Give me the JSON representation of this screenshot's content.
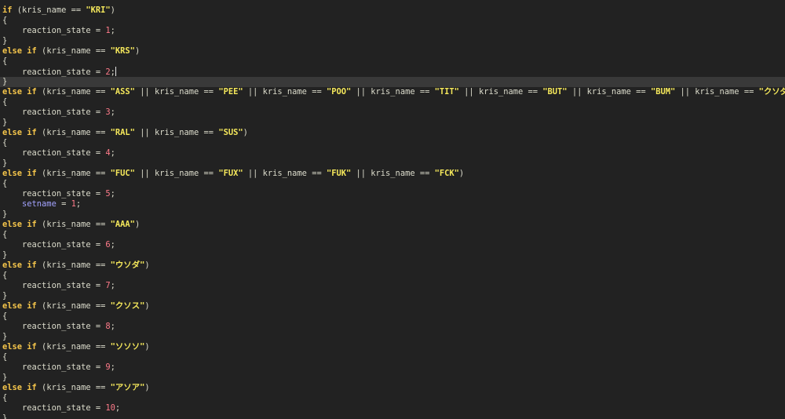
{
  "colors": {
    "background": "#222222",
    "current_line": "#393939",
    "keyword": "#f6c64b",
    "string": "#f5e85b",
    "number": "#ff7b8a",
    "variable": "#dcdccc",
    "builtin": "#a3a3ff"
  },
  "editor": {
    "current_line_index": 7,
    "lines": [
      [
        [
          "kw",
          "if"
        ],
        [
          "pun",
          " ("
        ],
        [
          "var",
          "kris_name"
        ],
        [
          "op",
          " == "
        ],
        [
          "str",
          "\"KRI\""
        ],
        [
          "pun",
          ")"
        ]
      ],
      [
        [
          "pun",
          "{"
        ]
      ],
      [
        [
          "pun",
          "    "
        ],
        [
          "var",
          "reaction_state"
        ],
        [
          "op",
          " = "
        ],
        [
          "num",
          "1"
        ],
        [
          "pun",
          ";"
        ]
      ],
      [
        [
          "pun",
          "}"
        ]
      ],
      [
        [
          "kw",
          "else if"
        ],
        [
          "pun",
          " ("
        ],
        [
          "var",
          "kris_name"
        ],
        [
          "op",
          " == "
        ],
        [
          "str",
          "\"KRS\""
        ],
        [
          "pun",
          ")"
        ]
      ],
      [
        [
          "pun",
          "{"
        ]
      ],
      [
        [
          "pun",
          "    "
        ],
        [
          "var",
          "reaction_state"
        ],
        [
          "op",
          " = "
        ],
        [
          "num",
          "2"
        ],
        [
          "pun",
          ";"
        ],
        [
          "cursor",
          ""
        ]
      ],
      [
        [
          "pun",
          "}"
        ]
      ],
      [
        [
          "kw",
          "else if"
        ],
        [
          "pun",
          " ("
        ],
        [
          "var",
          "kris_name"
        ],
        [
          "op",
          " == "
        ],
        [
          "str",
          "\"ASS\""
        ],
        [
          "op",
          " || "
        ],
        [
          "var",
          "kris_name"
        ],
        [
          "op",
          " == "
        ],
        [
          "str",
          "\"PEE\""
        ],
        [
          "op",
          " || "
        ],
        [
          "var",
          "kris_name"
        ],
        [
          "op",
          " == "
        ],
        [
          "str",
          "\"POO\""
        ],
        [
          "op",
          " || "
        ],
        [
          "var",
          "kris_name"
        ],
        [
          "op",
          " == "
        ],
        [
          "str",
          "\"TIT\""
        ],
        [
          "op",
          " || "
        ],
        [
          "var",
          "kris_name"
        ],
        [
          "op",
          " == "
        ],
        [
          "str",
          "\"BUT\""
        ],
        [
          "op",
          " || "
        ],
        [
          "var",
          "kris_name"
        ],
        [
          "op",
          " == "
        ],
        [
          "str",
          "\"BUM\""
        ],
        [
          "op",
          " || "
        ],
        [
          "var",
          "kris_name"
        ],
        [
          "op",
          " == "
        ],
        [
          "str",
          "\"クソダ\""
        ],
        [
          "pun",
          ")"
        ]
      ],
      [
        [
          "pun",
          "{"
        ]
      ],
      [
        [
          "pun",
          "    "
        ],
        [
          "var",
          "reaction_state"
        ],
        [
          "op",
          " = "
        ],
        [
          "num",
          "3"
        ],
        [
          "pun",
          ";"
        ]
      ],
      [
        [
          "pun",
          "}"
        ]
      ],
      [
        [
          "kw",
          "else if"
        ],
        [
          "pun",
          " ("
        ],
        [
          "var",
          "kris_name"
        ],
        [
          "op",
          " == "
        ],
        [
          "str",
          "\"RAL\""
        ],
        [
          "op",
          " || "
        ],
        [
          "var",
          "kris_name"
        ],
        [
          "op",
          " == "
        ],
        [
          "str",
          "\"SUS\""
        ],
        [
          "pun",
          ")"
        ]
      ],
      [
        [
          "pun",
          "{"
        ]
      ],
      [
        [
          "pun",
          "    "
        ],
        [
          "var",
          "reaction_state"
        ],
        [
          "op",
          " = "
        ],
        [
          "num",
          "4"
        ],
        [
          "pun",
          ";"
        ]
      ],
      [
        [
          "pun",
          "}"
        ]
      ],
      [
        [
          "kw",
          "else if"
        ],
        [
          "pun",
          " ("
        ],
        [
          "var",
          "kris_name"
        ],
        [
          "op",
          " == "
        ],
        [
          "str",
          "\"FUC\""
        ],
        [
          "op",
          " || "
        ],
        [
          "var",
          "kris_name"
        ],
        [
          "op",
          " == "
        ],
        [
          "str",
          "\"FUX\""
        ],
        [
          "op",
          " || "
        ],
        [
          "var",
          "kris_name"
        ],
        [
          "op",
          " == "
        ],
        [
          "str",
          "\"FUK\""
        ],
        [
          "op",
          " || "
        ],
        [
          "var",
          "kris_name"
        ],
        [
          "op",
          " == "
        ],
        [
          "str",
          "\"FCK\""
        ],
        [
          "pun",
          ")"
        ]
      ],
      [
        [
          "pun",
          "{"
        ]
      ],
      [
        [
          "pun",
          "    "
        ],
        [
          "var",
          "reaction_state"
        ],
        [
          "op",
          " = "
        ],
        [
          "num",
          "5"
        ],
        [
          "pun",
          ";"
        ]
      ],
      [
        [
          "pun",
          "    "
        ],
        [
          "bl",
          "setname"
        ],
        [
          "op",
          " = "
        ],
        [
          "num",
          "1"
        ],
        [
          "pun",
          ";"
        ]
      ],
      [
        [
          "pun",
          "}"
        ]
      ],
      [
        [
          "kw",
          "else if"
        ],
        [
          "pun",
          " ("
        ],
        [
          "var",
          "kris_name"
        ],
        [
          "op",
          " == "
        ],
        [
          "str",
          "\"AAA\""
        ],
        [
          "pun",
          ")"
        ]
      ],
      [
        [
          "pun",
          "{"
        ]
      ],
      [
        [
          "pun",
          "    "
        ],
        [
          "var",
          "reaction_state"
        ],
        [
          "op",
          " = "
        ],
        [
          "num",
          "6"
        ],
        [
          "pun",
          ";"
        ]
      ],
      [
        [
          "pun",
          "}"
        ]
      ],
      [
        [
          "kw",
          "else if"
        ],
        [
          "pun",
          " ("
        ],
        [
          "var",
          "kris_name"
        ],
        [
          "op",
          " == "
        ],
        [
          "str",
          "\"ウソダ\""
        ],
        [
          "pun",
          ")"
        ]
      ],
      [
        [
          "pun",
          "{"
        ]
      ],
      [
        [
          "pun",
          "    "
        ],
        [
          "var",
          "reaction_state"
        ],
        [
          "op",
          " = "
        ],
        [
          "num",
          "7"
        ],
        [
          "pun",
          ";"
        ]
      ],
      [
        [
          "pun",
          "}"
        ]
      ],
      [
        [
          "kw",
          "else if"
        ],
        [
          "pun",
          " ("
        ],
        [
          "var",
          "kris_name"
        ],
        [
          "op",
          " == "
        ],
        [
          "str",
          "\"クソス\""
        ],
        [
          "pun",
          ")"
        ]
      ],
      [
        [
          "pun",
          "{"
        ]
      ],
      [
        [
          "pun",
          "    "
        ],
        [
          "var",
          "reaction_state"
        ],
        [
          "op",
          " = "
        ],
        [
          "num",
          "8"
        ],
        [
          "pun",
          ";"
        ]
      ],
      [
        [
          "pun",
          "}"
        ]
      ],
      [
        [
          "kw",
          "else if"
        ],
        [
          "pun",
          " ("
        ],
        [
          "var",
          "kris_name"
        ],
        [
          "op",
          " == "
        ],
        [
          "str",
          "\"ソソソ\""
        ],
        [
          "pun",
          ")"
        ]
      ],
      [
        [
          "pun",
          "{"
        ]
      ],
      [
        [
          "pun",
          "    "
        ],
        [
          "var",
          "reaction_state"
        ],
        [
          "op",
          " = "
        ],
        [
          "num",
          "9"
        ],
        [
          "pun",
          ";"
        ]
      ],
      [
        [
          "pun",
          "}"
        ]
      ],
      [
        [
          "kw",
          "else if"
        ],
        [
          "pun",
          " ("
        ],
        [
          "var",
          "kris_name"
        ],
        [
          "op",
          " == "
        ],
        [
          "str",
          "\"アソア\""
        ],
        [
          "pun",
          ")"
        ]
      ],
      [
        [
          "pun",
          "{"
        ]
      ],
      [
        [
          "pun",
          "    "
        ],
        [
          "var",
          "reaction_state"
        ],
        [
          "op",
          " = "
        ],
        [
          "num",
          "10"
        ],
        [
          "pun",
          ";"
        ]
      ],
      [
        [
          "pun",
          "}"
        ]
      ]
    ]
  }
}
